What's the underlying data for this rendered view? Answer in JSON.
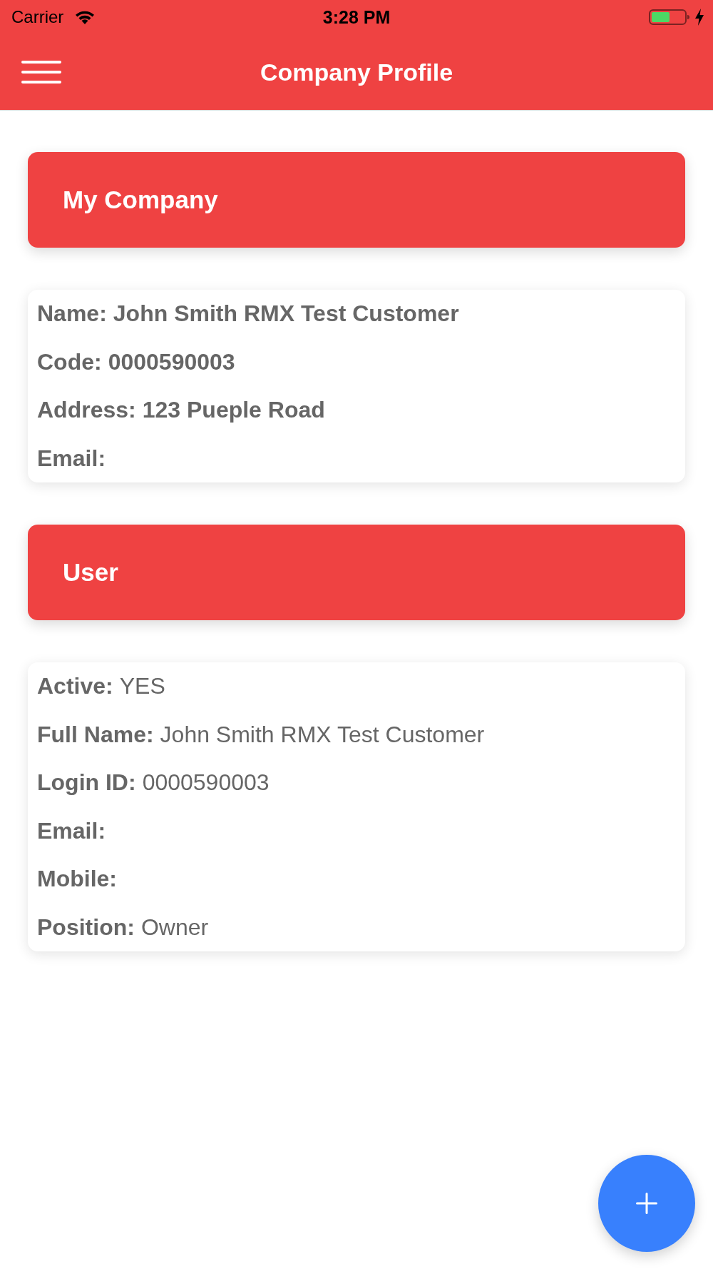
{
  "status_bar": {
    "carrier": "Carrier",
    "time": "3:28 PM"
  },
  "header": {
    "title": "Company Profile"
  },
  "sections": [
    {
      "title": "My Company",
      "kind": "bold",
      "fields": [
        {
          "label": "Name:",
          "value": "John Smith RMX Test Customer"
        },
        {
          "label": "Code:",
          "value": "0000590003"
        },
        {
          "label": "Address:",
          "value": "123 Pueple Road"
        },
        {
          "label": "Email:"
        }
      ]
    },
    {
      "title": "User",
      "kind": "plain",
      "fields": [
        {
          "label": "Active:",
          "value": "YES"
        },
        {
          "label": "Full Name:",
          "value": "John Smith RMX Test Customer"
        },
        {
          "label": "Login ID:",
          "value": "0000590003"
        },
        {
          "label": "Email:"
        },
        {
          "label": "Mobile:"
        },
        {
          "label": "Position:",
          "value": "Owner"
        }
      ]
    }
  ]
}
